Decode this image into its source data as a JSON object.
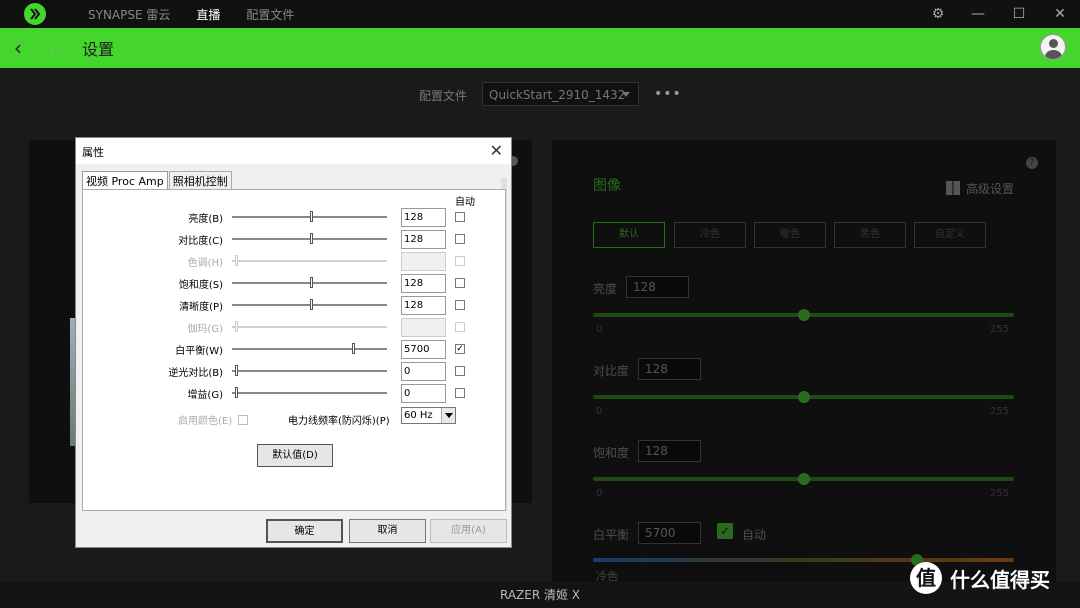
{
  "app": {
    "nav": [
      "SYNAPSE 雷云",
      "直播",
      "配置文件"
    ],
    "active_nav": "直播",
    "window_controls": [
      "⚙",
      "—",
      "☐",
      "✕"
    ],
    "header_title": "设置",
    "status_bar": "RAZER 清姬 X"
  },
  "profile": {
    "label": "配置文件",
    "value": "QuickStart_2910_1432",
    "more": "•••"
  },
  "right_panel": {
    "title": "图像",
    "advanced": "高级设置",
    "presets": [
      "默认",
      "冷色",
      "暖色",
      "黑色",
      "自定义"
    ],
    "controls": [
      {
        "label": "亮度",
        "value": "128",
        "min": "0",
        "max": "255",
        "fraction": 0.5
      },
      {
        "label": "对比度",
        "value": "128",
        "min": "0",
        "max": "255",
        "fraction": 0.5
      },
      {
        "label": "饱和度",
        "value": "128",
        "min": "0",
        "max": "255",
        "fraction": 0.5
      }
    ],
    "white_balance": {
      "label": "白平衡",
      "value": "5700",
      "auto_label": "自动",
      "cold_label": "冷色",
      "fraction": 0.77
    }
  },
  "dialog": {
    "title": "属性",
    "tabs": [
      "视频 Proc Amp",
      "照相机控制"
    ],
    "auto_header": "自动",
    "properties": [
      {
        "label": "亮度(B)",
        "value": "128",
        "fraction": 0.5,
        "disabled": false,
        "checked": false
      },
      {
        "label": "对比度(C)",
        "value": "128",
        "fraction": 0.5,
        "disabled": false,
        "checked": false
      },
      {
        "label": "色调(H)",
        "value": "",
        "fraction": 0.0,
        "disabled": true,
        "checked": false
      },
      {
        "label": "饱和度(S)",
        "value": "128",
        "fraction": 0.5,
        "disabled": false,
        "checked": false
      },
      {
        "label": "清晰度(P)",
        "value": "128",
        "fraction": 0.5,
        "disabled": false,
        "checked": false
      },
      {
        "label": "伽玛(G)",
        "value": "",
        "fraction": 0.0,
        "disabled": true,
        "checked": false
      },
      {
        "label": "白平衡(W)",
        "value": "5700",
        "fraction": 0.78,
        "disabled": false,
        "checked": true
      },
      {
        "label": "逆光对比(B)",
        "value": "0",
        "fraction": 0.0,
        "disabled": false,
        "checked": false
      },
      {
        "label": "增益(G)",
        "value": "0",
        "fraction": 0.0,
        "disabled": false,
        "checked": false
      }
    ],
    "enable_color": "启用颜色(E)",
    "power_freq_label": "电力线频率(防闪烁)(P)",
    "power_freq_value": "60 Hz",
    "default_button": "默认值(D)",
    "ok": "确定",
    "cancel": "取消",
    "apply": "应用(A)"
  },
  "watermark": {
    "icon": "值",
    "text": "什么值得买"
  }
}
